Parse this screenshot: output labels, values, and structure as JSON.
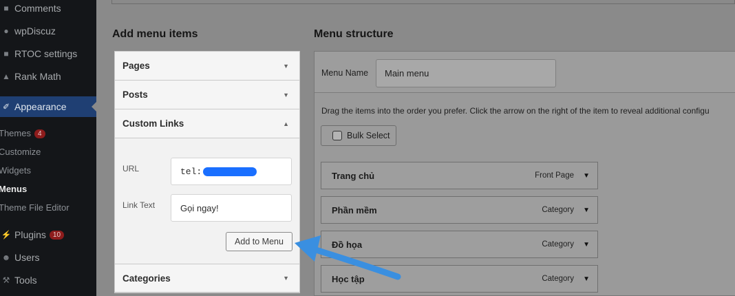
{
  "sidebar": {
    "items": [
      {
        "label": "Comments",
        "icon": "comments-icon"
      },
      {
        "label": "wpDiscuz",
        "icon": "wpdiscuz-icon"
      },
      {
        "label": "RTOC settings",
        "icon": "settings-icon"
      },
      {
        "label": "Rank Math",
        "icon": "rank-math-icon"
      },
      {
        "label": "Appearance",
        "icon": "brush-icon"
      },
      {
        "label": "Plugins",
        "icon": "plugin-icon",
        "badge": "10"
      },
      {
        "label": "Users",
        "icon": "users-icon"
      },
      {
        "label": "Tools",
        "icon": "tools-icon"
      }
    ],
    "submenu": [
      {
        "label": "Themes",
        "badge": "4"
      },
      {
        "label": "Customize"
      },
      {
        "label": "Widgets"
      },
      {
        "label": "Menus"
      },
      {
        "label": "Theme File Editor"
      }
    ]
  },
  "add_items": {
    "heading": "Add menu items",
    "sections": {
      "pages": "Pages",
      "posts": "Posts",
      "custom_links": "Custom Links",
      "categories": "Categories"
    },
    "url_label": "URL",
    "url_value": "tel:",
    "link_text_label": "Link Text",
    "link_text_value": "Gọi ngay!",
    "add_button": "Add to Menu"
  },
  "menu_structure": {
    "heading": "Menu structure",
    "menu_name_label": "Menu Name",
    "menu_name_value": "Main menu",
    "drag_hint": "Drag the items into the order you prefer. Click the arrow on the right of the item to reveal additional configu",
    "bulk_select": "Bulk Select",
    "items": [
      {
        "title": "Trang chủ",
        "type": "Front Page"
      },
      {
        "title": "Phần mềm",
        "type": "Category"
      },
      {
        "title": "Đồ họa",
        "type": "Category"
      },
      {
        "title": "Học tập",
        "type": "Category"
      }
    ]
  },
  "colors": {
    "sidebar_bg": "#141619",
    "active_bg": "#1f3f73",
    "annotation_arrow": "#3a8fe0",
    "redaction": "#1a6fff"
  }
}
